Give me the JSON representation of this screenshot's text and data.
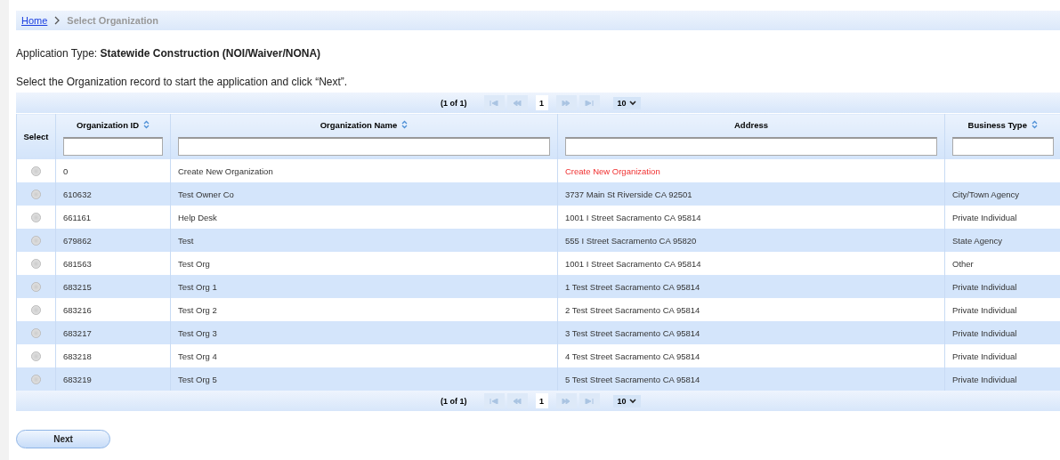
{
  "breadcrumb": {
    "items": [
      {
        "label": "Home",
        "kind": "link"
      },
      {
        "label": "Select Organization",
        "kind": "current"
      }
    ]
  },
  "application_type": {
    "label": "Application Type:",
    "value": "Statewide Construction (NOI/Waiver/NONA)"
  },
  "instruction": "Select the Organization record to start the application and click “Next”.",
  "table": {
    "top_pager": {
      "summary": "(1 of 1)",
      "page": "1",
      "page_size": "10"
    },
    "columns": [
      {
        "label": "Select",
        "sortable": false,
        "filter": false
      },
      {
        "label": "Organization ID",
        "sortable": true,
        "filter": true
      },
      {
        "label": "Organization Name",
        "sortable": true,
        "filter": true
      },
      {
        "label": "Address",
        "sortable": false,
        "filter": true
      },
      {
        "label": "Business Type",
        "sortable": true,
        "filter": true
      }
    ],
    "rows": [
      {
        "selected": false,
        "kind": "new",
        "id": "0",
        "name": "Create New Organization",
        "address": "Create New Organization",
        "business_type": ""
      },
      {
        "selected": false,
        "kind": "record",
        "id": "610632",
        "name": "Test Owner Co",
        "address": "3737 Main St Riverside CA 92501",
        "business_type": "City/Town Agency"
      },
      {
        "selected": false,
        "kind": "record",
        "id": "661161",
        "name": "Help Desk",
        "address": "1001 I Street Sacramento CA 95814",
        "business_type": "Private Individual"
      },
      {
        "selected": false,
        "kind": "record",
        "id": "679862",
        "name": "Test",
        "address": "555 I Street Sacramento CA 95820",
        "business_type": "State Agency"
      },
      {
        "selected": false,
        "kind": "record",
        "id": "681563",
        "name": "Test Org",
        "address": "1001 I Street Sacramento CA 95814",
        "business_type": "Other"
      },
      {
        "selected": false,
        "kind": "record",
        "id": "683215",
        "name": "Test Org 1",
        "address": "1 Test Street Sacramento CA 95814",
        "business_type": "Private Individual"
      },
      {
        "selected": false,
        "kind": "record",
        "id": "683216",
        "name": "Test Org 2",
        "address": "2 Test Street Sacramento CA 95814",
        "business_type": "Private Individual"
      },
      {
        "selected": false,
        "kind": "record",
        "id": "683217",
        "name": "Test Org 3",
        "address": "3 Test Street Sacramento CA 95814",
        "business_type": "Private Individual"
      },
      {
        "selected": false,
        "kind": "record",
        "id": "683218",
        "name": "Test Org 4",
        "address": "4 Test Street Sacramento CA 95814",
        "business_type": "Private Individual"
      },
      {
        "selected": false,
        "kind": "record",
        "id": "683219",
        "name": "Test Org 5",
        "address": "5 Test Street Sacramento CA 95814",
        "business_type": "Private Individual"
      }
    ],
    "bottom_pager": {
      "summary": "(1 of 1)",
      "page": "1",
      "page_size": "10"
    }
  },
  "buttons": [
    {
      "label": "Next"
    }
  ]
}
